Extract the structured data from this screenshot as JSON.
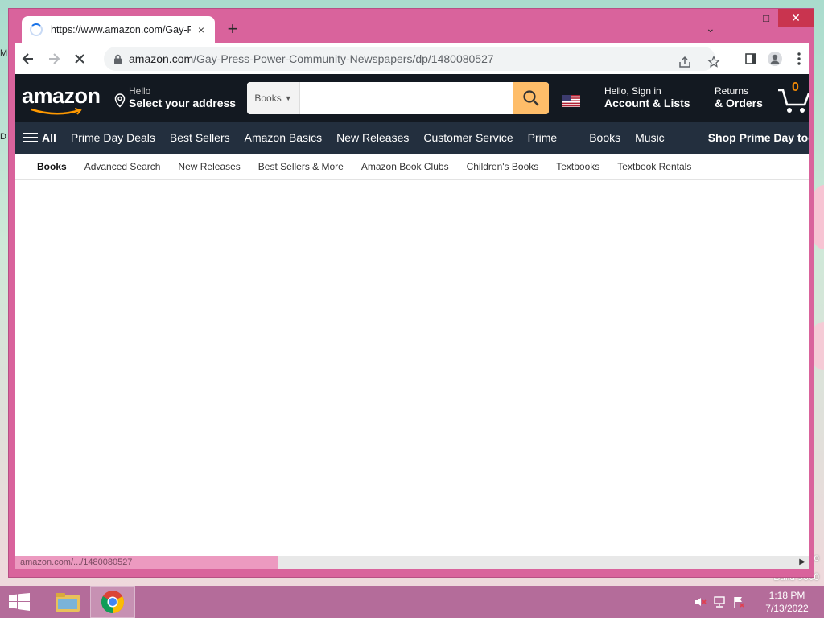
{
  "browser": {
    "tab": {
      "title": "https://www.amazon.com/Gay-P",
      "close": "×"
    },
    "new_tab": "+",
    "tab_search": "⌄",
    "window_controls": {
      "minimize": "–",
      "maximize": "□",
      "close": "✕"
    },
    "address": {
      "domain": "amazon.com",
      "path": "/Gay-Press-Power-Community-Newspapers/dp/1480080527"
    },
    "status_url": "amazon.com/.../1480080527"
  },
  "amazon": {
    "logo": "amazon",
    "location": {
      "hello": "Hello",
      "address": "Select your address"
    },
    "search": {
      "category": "Books",
      "placeholder": ""
    },
    "account": {
      "line1": "Hello, Sign in",
      "line2": "Account & Lists"
    },
    "returns": {
      "line1": "Returns",
      "line2": "& Orders"
    },
    "cart": {
      "count": "0"
    },
    "main_nav": {
      "all": "All",
      "items": [
        "Prime Day Deals",
        "Best Sellers",
        "Amazon Basics",
        "New Releases",
        "Customer Service",
        "Prime",
        "Books",
        "Music"
      ],
      "promo": "Shop Prime Day today"
    },
    "sub_nav": [
      "Books",
      "Advanced Search",
      "New Releases",
      "Best Sellers & More",
      "Amazon Book Clubs",
      "Children's Books",
      "Textbooks",
      "Textbook Rentals"
    ]
  },
  "desktop": {
    "peek_left_1": "M",
    "peek_left_2": "D",
    "right_text_1": "o",
    "right_text_2": "Build 9600"
  },
  "taskbar": {
    "time": "1:18 PM",
    "date": "7/13/2022"
  },
  "colors": {
    "window_frame": "#d9639c",
    "amazon_nav_top": "#131921",
    "amazon_nav_main": "#232f3e",
    "search_button": "#febd69",
    "taskbar": "#b46c9a"
  }
}
